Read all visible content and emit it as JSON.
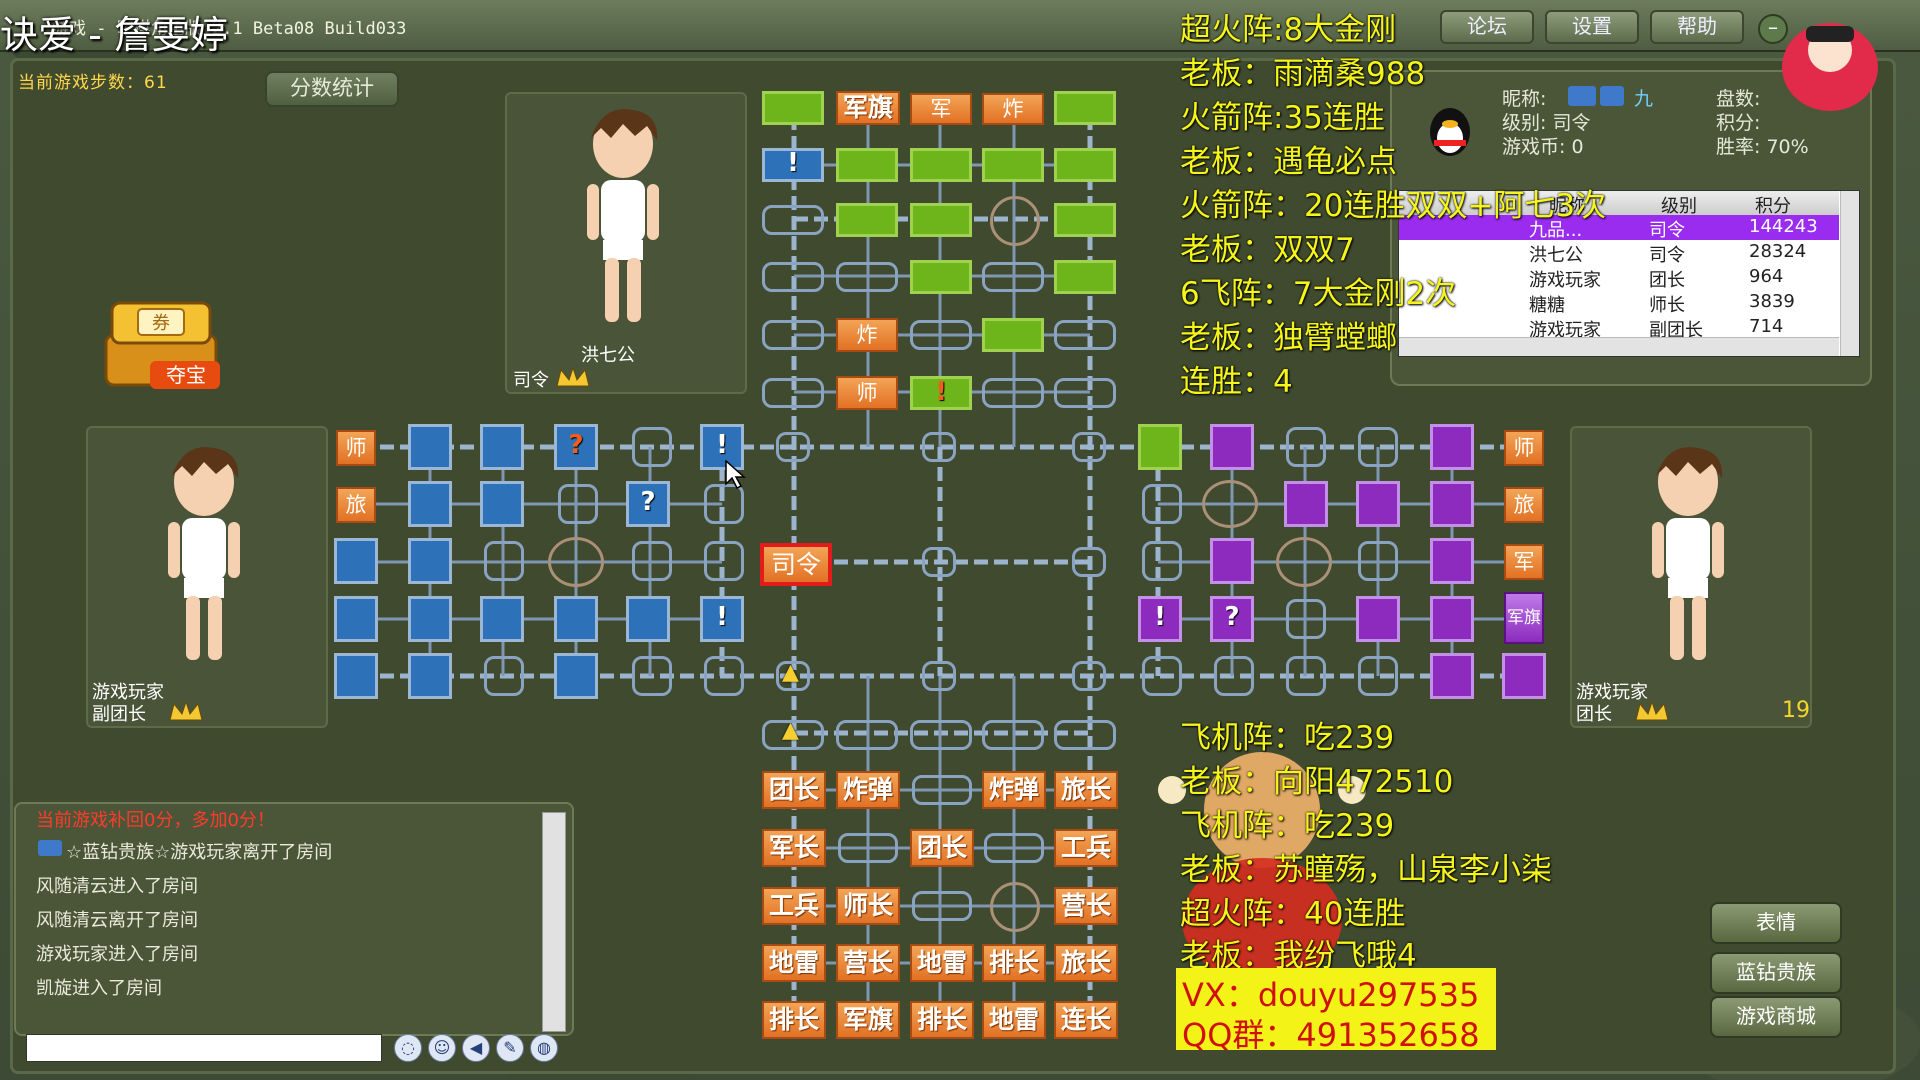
{
  "window": {
    "title": "游戏 - 军棋角色版 2.1 Beta08 Build033",
    "overlay_name": "诀爱 - 詹雯婷"
  },
  "toolbar": {
    "forum_label": "论坛",
    "settings_label": "设置",
    "help_label": "帮助",
    "minimize_label": "–"
  },
  "game": {
    "steps_label": "当前游戏步数：61",
    "score_button_label": "分数统计"
  },
  "players": {
    "top": {
      "name": "洪七公",
      "rank": "司令"
    },
    "left": {
      "name": "游戏玩家",
      "rank": "副团长"
    },
    "right": {
      "name": "游戏玩家",
      "rank": "团长",
      "timer": "19"
    }
  },
  "treasure": {
    "label": "夺宝",
    "coupon": "券"
  },
  "board": {
    "top_pieces": [
      "军旗",
      "军",
      "炸",
      "!",
      "炸",
      "师",
      "!"
    ],
    "left_pieces": [
      "师",
      "旅",
      "?",
      "?",
      "!",
      "!"
    ],
    "right_pieces": [
      "师",
      "旅",
      "军",
      "军旗",
      "!",
      "?"
    ],
    "center_selected": "司令",
    "bottom_rows": [
      [
        "团长",
        "炸弹",
        "",
        "炸弹",
        "旅长"
      ],
      [
        "军长",
        "",
        "团长",
        "",
        "工兵"
      ],
      [
        "工兵",
        "师长",
        "",
        "",
        "营长"
      ],
      [
        "地雷",
        "营长",
        "地雷",
        "排长",
        "旅长"
      ],
      [
        "排长",
        "军旗",
        "排长",
        "地雷",
        "连长"
      ]
    ]
  },
  "info": {
    "nickname_label": "昵称:",
    "nickname_value": "九",
    "level_label": "级别: 司令",
    "coins_label": "游戏币: 0",
    "games_label": "盘数:",
    "points_label": "积分:",
    "winrate_label": "胜率: 70%"
  },
  "player_list": {
    "headers": [
      "昵称",
      "级别",
      "积分"
    ],
    "rows": [
      {
        "name": "九品...",
        "rank": "司令",
        "score": "144243",
        "selected": true
      },
      {
        "name": "洪七公",
        "rank": "司令",
        "score": "28324",
        "selected": false
      },
      {
        "name": "游戏玩家",
        "rank": "团长",
        "score": "964",
        "selected": false
      },
      {
        "name": "糖糖",
        "rank": "师长",
        "score": "3839",
        "selected": false
      },
      {
        "name": "游戏玩家",
        "rank": "副团长",
        "score": "714",
        "selected": false
      }
    ]
  },
  "stream_overlay_top": [
    "超火阵:8大金刚",
    "老板：雨滴桑988",
    "火箭阵:35连胜",
    "老板：遇龟必点",
    "火箭阵：20连胜双双+阿七3次",
    "老板：双双7",
    "6飞阵：7大金刚2次",
    "老板：独臂螳螂",
    "连胜：4"
  ],
  "stream_overlay_bottom": [
    "飞机阵：吃239",
    "老板：向阳472510",
    "飞机阵：吃239",
    "老板：苏瞳殇，山泉李小柒",
    "超火阵：40连胜",
    "老板：我纷飞哦4"
  ],
  "contact": {
    "vx": "VX：douyu297535",
    "qq": "QQ群：491352658"
  },
  "chat": {
    "lines": [
      "当前游戏补回0分，多加0分！",
      "☆蓝钻贵族☆游戏玩家离开了房间",
      "风随清云进入了房间",
      "风随清云离开了房间",
      "游戏玩家进入了房间",
      "凯旋进入了房间"
    ]
  },
  "side_buttons": {
    "emoji": "表情",
    "bluediamond": "蓝钻贵族",
    "mall": "游戏商城"
  },
  "colors": {
    "green_piece": "#6db51a",
    "blue_piece": "#2d71b8",
    "purple_piece": "#8c2bbd",
    "orange_piece": "#e27124",
    "overlay_text": "#f5f51a",
    "selected_row": "#9a2cf0"
  }
}
